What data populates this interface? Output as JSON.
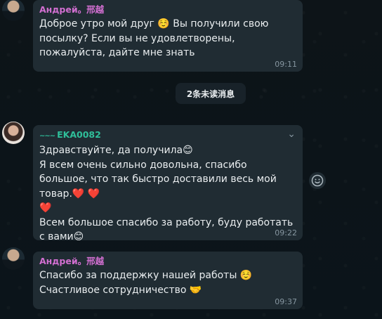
{
  "messages": [
    {
      "sender": "Андрей。邢越",
      "text": "Доброе утро мой друг ☺️  Вы получили свою посылку? Если вы не удовлетворены, пожалуйста, дайте мне знать",
      "time": "09:11"
    },
    {
      "sender_prefix": "~~~",
      "sender": "EKA0082",
      "text": "Здравствуйте, да получила😊\nЯ всем очень сильно довольна, спасибо большое, что так быстро доставили весь мой товар.❤️ ❤️\n❤️\nВсем большое спасибо за работу, буду работать с вами😊",
      "time": "09:22"
    },
    {
      "sender": "Андрей。邢越",
      "text": "Спасибо за поддержку нашей работы ☺️\nСчастливое сотрудничество 🤝",
      "time": "09:37"
    }
  ],
  "unread_banner": "2条未读消息",
  "colors": {
    "bubble": "#202c33",
    "sender_pink": "#d26fd1",
    "sender_teal": "#2fbf9a"
  },
  "icons": {
    "dropdown": "chevron-down-icon",
    "reaction": "emoji-icon"
  }
}
